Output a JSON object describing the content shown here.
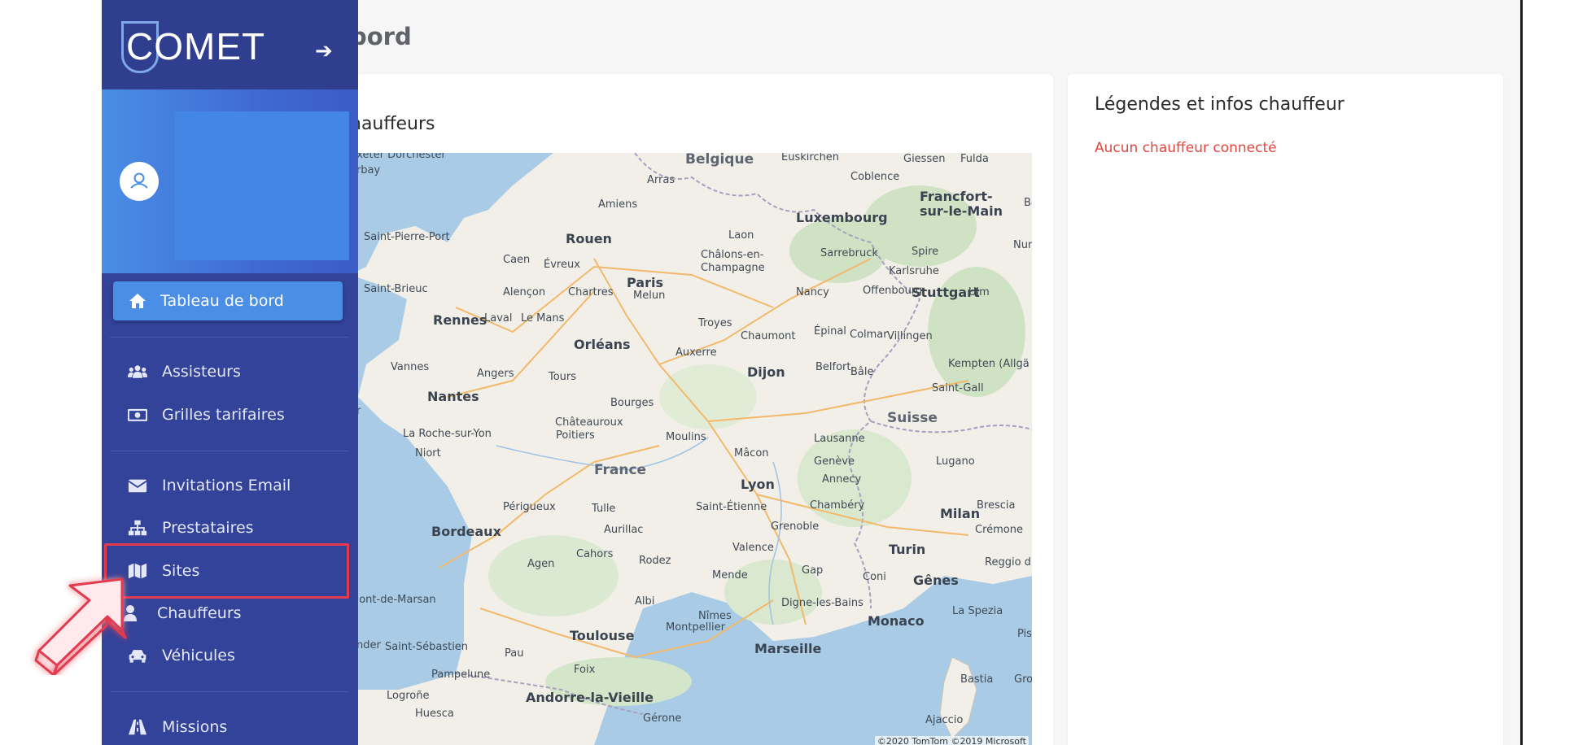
{
  "app": {
    "brand": "COMET",
    "page_title": "bord"
  },
  "map_card": {
    "title": "hauffeurs",
    "attribution": "©2020 TomTom ©2019 Microsoft",
    "cities": [
      {
        "name": "Belgique",
        "cls": "country"
      },
      {
        "name": "Euskirchen",
        "cls": ""
      },
      {
        "name": "Giessen",
        "cls": ""
      },
      {
        "name": "Fulda",
        "cls": ""
      },
      {
        "name": "Arras",
        "cls": ""
      },
      {
        "name": "Coblence",
        "cls": ""
      },
      {
        "name": "Francfort-",
        "cls": "big"
      },
      {
        "name": "sur-le-Main",
        "cls": "big"
      },
      {
        "name": "Bamb",
        "cls": ""
      },
      {
        "name": "Amiens",
        "cls": ""
      },
      {
        "name": "Luxembourg",
        "cls": "big"
      },
      {
        "name": "Saint-Pierre-Port",
        "cls": ""
      },
      {
        "name": "Rouen",
        "cls": "big"
      },
      {
        "name": "Laon",
        "cls": ""
      },
      {
        "name": "Sarrebruck",
        "cls": ""
      },
      {
        "name": "Spire",
        "cls": ""
      },
      {
        "name": "Nuren",
        "cls": ""
      },
      {
        "name": "Caen",
        "cls": ""
      },
      {
        "name": "Évreux",
        "cls": ""
      },
      {
        "name": "Châlons-en-",
        "cls": ""
      },
      {
        "name": "Champagne",
        "cls": ""
      },
      {
        "name": "Karlsruhe",
        "cls": ""
      },
      {
        "name": "Paris",
        "cls": "big"
      },
      {
        "name": "Stuttgart",
        "cls": "big"
      },
      {
        "name": "Saint-Brieuc",
        "cls": ""
      },
      {
        "name": "Alençon",
        "cls": ""
      },
      {
        "name": "Chartres",
        "cls": ""
      },
      {
        "name": "Melun",
        "cls": ""
      },
      {
        "name": "Nancy",
        "cls": ""
      },
      {
        "name": "Offenbourg",
        "cls": ""
      },
      {
        "name": "Ulm",
        "cls": ""
      },
      {
        "name": "Troyes",
        "cls": ""
      },
      {
        "name": "Rennes",
        "cls": "big"
      },
      {
        "name": "Laval",
        "cls": ""
      },
      {
        "name": "Le Mans",
        "cls": ""
      },
      {
        "name": "Chaumont",
        "cls": ""
      },
      {
        "name": "Épinal",
        "cls": ""
      },
      {
        "name": "Colmar",
        "cls": ""
      },
      {
        "name": "Villingen",
        "cls": ""
      },
      {
        "name": "Orléans",
        "cls": "big"
      },
      {
        "name": "Auxerre",
        "cls": ""
      },
      {
        "name": "Vannes",
        "cls": ""
      },
      {
        "name": "Kempten (Allgä",
        "cls": ""
      },
      {
        "name": "Belfort",
        "cls": ""
      },
      {
        "name": "Bâle",
        "cls": ""
      },
      {
        "name": "Angers",
        "cls": ""
      },
      {
        "name": "Tours",
        "cls": ""
      },
      {
        "name": "Dijon",
        "cls": "big"
      },
      {
        "name": "Saint-Gall",
        "cls": ""
      },
      {
        "name": "Nantes",
        "cls": "big"
      },
      {
        "name": "Bourges",
        "cls": ""
      },
      {
        "name": "Suisse",
        "cls": "country"
      },
      {
        "name": "Châteauroux",
        "cls": ""
      },
      {
        "name": "La Roche-sur-Yon",
        "cls": ""
      },
      {
        "name": "Poitiers",
        "cls": ""
      },
      {
        "name": "Moulins",
        "cls": ""
      },
      {
        "name": "Lausanne",
        "cls": ""
      },
      {
        "name": "Niort",
        "cls": ""
      },
      {
        "name": "Mâcon",
        "cls": ""
      },
      {
        "name": "Genève",
        "cls": ""
      },
      {
        "name": "Lugano",
        "cls": ""
      },
      {
        "name": "France",
        "cls": "country"
      },
      {
        "name": "Annecy",
        "cls": ""
      },
      {
        "name": "Lyon",
        "cls": "big"
      },
      {
        "name": "Chambéry",
        "cls": ""
      },
      {
        "name": "Brescia",
        "cls": ""
      },
      {
        "name": "Saint-Étienne",
        "cls": ""
      },
      {
        "name": "Milan",
        "cls": "big"
      },
      {
        "name": "Périgueux",
        "cls": ""
      },
      {
        "name": "Tulle",
        "cls": ""
      },
      {
        "name": "Grenoble",
        "cls": ""
      },
      {
        "name": "Crémone",
        "cls": ""
      },
      {
        "name": "Bordeaux",
        "cls": "big"
      },
      {
        "name": "Aurillac",
        "cls": ""
      },
      {
        "name": "Valence",
        "cls": ""
      },
      {
        "name": "Turin",
        "cls": "big"
      },
      {
        "name": "Reggio d'Ém",
        "cls": ""
      },
      {
        "name": "Cahors",
        "cls": ""
      },
      {
        "name": "Gap",
        "cls": ""
      },
      {
        "name": "Agen",
        "cls": ""
      },
      {
        "name": "Rodez",
        "cls": ""
      },
      {
        "name": "Mende",
        "cls": ""
      },
      {
        "name": "Coni",
        "cls": ""
      },
      {
        "name": "Gênes",
        "cls": "big"
      },
      {
        "name": "Mont-de-Marsan",
        "cls": ""
      },
      {
        "name": "Albi",
        "cls": ""
      },
      {
        "name": "Digne-les-Bains",
        "cls": ""
      },
      {
        "name": "La Spezia",
        "cls": ""
      },
      {
        "name": "Nîmes",
        "cls": ""
      },
      {
        "name": "Monaco",
        "cls": "big"
      },
      {
        "name": "Pise",
        "cls": ""
      },
      {
        "name": "Toulouse",
        "cls": "big"
      },
      {
        "name": "Montpellier",
        "cls": ""
      },
      {
        "name": "Marseille",
        "cls": "big"
      },
      {
        "name": "Saint-Sébastien",
        "cls": ""
      },
      {
        "name": "Pau",
        "cls": ""
      },
      {
        "name": "Foix",
        "cls": ""
      },
      {
        "name": "Pampelune",
        "cls": ""
      },
      {
        "name": "Bastia",
        "cls": ""
      },
      {
        "name": "Gro",
        "cls": ""
      },
      {
        "name": "Logroñe",
        "cls": ""
      },
      {
        "name": "Andorre-la-Vieille",
        "cls": "big"
      },
      {
        "name": "Huesca",
        "cls": ""
      },
      {
        "name": "Gérone",
        "cls": ""
      },
      {
        "name": "Ajaccio",
        "cls": ""
      },
      {
        "name": "ander",
        "cls": ""
      },
      {
        "name": "Exeter Dorchester",
        "cls": ""
      },
      {
        "name": "orbay",
        "cls": ""
      },
      {
        "name": "er",
        "cls": ""
      }
    ]
  },
  "legend_card": {
    "title": "Légendes et infos chauffeur",
    "empty_text": "Aucun chauffeur connecté"
  },
  "sidebar": {
    "items": [
      {
        "label": "Tableau de bord",
        "icon": "home-icon",
        "active": true
      },
      {
        "label": "Assisteurs",
        "icon": "users-icon"
      },
      {
        "label": "Grilles tarifaires",
        "icon": "money-bill-icon"
      },
      {
        "label": "Invitations Email",
        "icon": "envelope-icon"
      },
      {
        "label": "Prestataires",
        "icon": "sitemap-icon"
      },
      {
        "label": "Sites",
        "icon": "map-icon"
      },
      {
        "label": "Chauffeurs",
        "icon": "user-icon"
      },
      {
        "label": "Véhicules",
        "icon": "car-icon"
      },
      {
        "label": "Missions",
        "icon": "road-icon"
      }
    ]
  },
  "colors": {
    "sidebar": "#33439a",
    "accent": "#4a8ee6",
    "highlight": "#e23a4f",
    "error_text": "#e0473f"
  }
}
